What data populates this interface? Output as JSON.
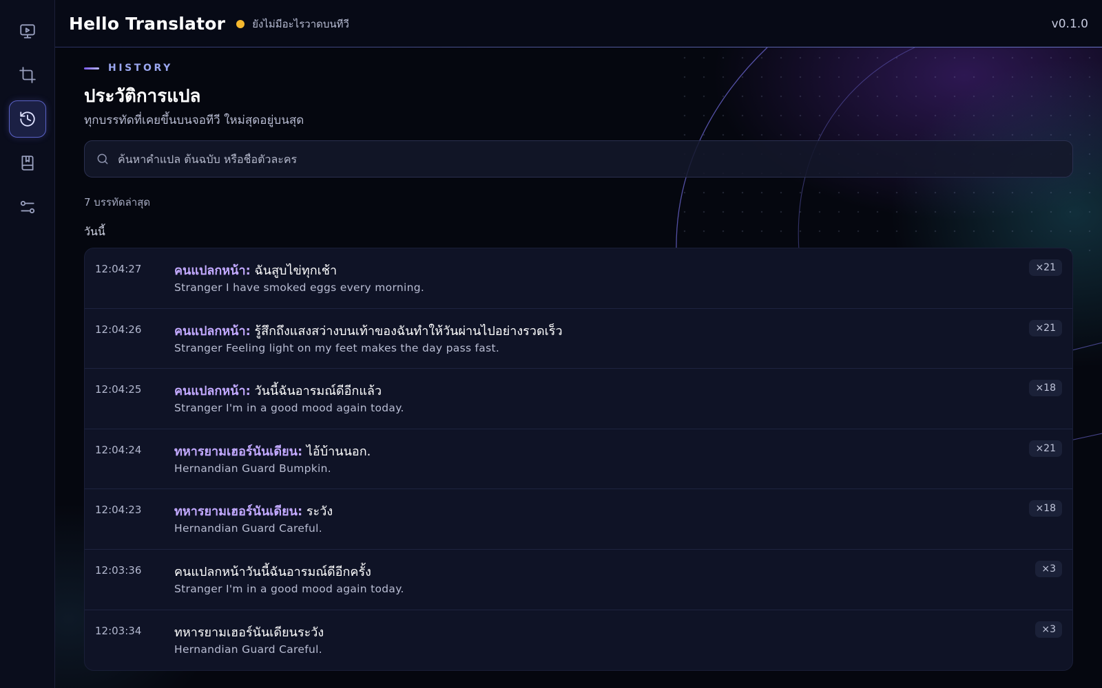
{
  "header": {
    "title": "Hello Translator",
    "status_text": "ยังไม่มีอะไรวาดบนทีวี",
    "version": "v0.1.0",
    "status_color": "#f5b82e"
  },
  "sidebar": {
    "items": [
      {
        "icon": "monitor-play-icon",
        "active": false
      },
      {
        "icon": "crop-icon",
        "active": false
      },
      {
        "icon": "history-icon",
        "active": true
      },
      {
        "icon": "book-icon",
        "active": false
      },
      {
        "icon": "sliders-icon",
        "active": false
      }
    ]
  },
  "page": {
    "eyebrow": "HISTORY",
    "title": "ประวัติการแปล",
    "subtitle": "ทุกบรรทัดที่เคยขึ้นบนจอทีวี ใหม่สุดอยู่บนสุด"
  },
  "search": {
    "placeholder": "ค้นหาคำแปล ต้นฉบับ หรือชื่อตัวละคร",
    "value": ""
  },
  "history": {
    "count_text": "7 บรรทัดล่าสุด",
    "group_label": "วันนี้",
    "rows": [
      {
        "time": "12:04:27",
        "speaker": "คนแปลกหน้า:",
        "text": " ฉันสูบไข่ทุกเช้า",
        "translation": "Stranger I have smoked eggs every morning.",
        "count": "×21"
      },
      {
        "time": "12:04:26",
        "speaker": "คนแปลกหน้า:",
        "text": " รู้สึกถึงแสงสว่างบนเท้าของฉันทำให้วันผ่านไปอย่างรวดเร็ว",
        "translation": "Stranger Feeling light on my feet makes the day pass fast.",
        "count": "×21"
      },
      {
        "time": "12:04:25",
        "speaker": "คนแปลกหน้า:",
        "text": " วันนี้ฉันอารมณ์ดีอีกแล้ว",
        "translation": "Stranger I'm in a good mood again today.",
        "count": "×18"
      },
      {
        "time": "12:04:24",
        "speaker": "ทหารยามเฮอร์นันเดียน:",
        "text": " ไอ้บ้านนอก.",
        "translation": "Hernandian Guard Bumpkin.",
        "count": "×21"
      },
      {
        "time": "12:04:23",
        "speaker": "ทหารยามเฮอร์นันเดียน:",
        "text": " ระวัง",
        "translation": "Hernandian Guard Careful.",
        "count": "×18"
      },
      {
        "time": "12:03:36",
        "speaker": "",
        "text": "คนแปลกหน้าวันนี้ฉันอารมณ์ดีอีกครั้ง",
        "translation": "Stranger I'm in a good mood again today.",
        "count": "×3"
      },
      {
        "time": "12:03:34",
        "speaker": "",
        "text": "ทหารยามเฮอร์นันเดียนระวัง",
        "translation": "Hernandian Guard Careful.",
        "count": "×3"
      }
    ]
  }
}
